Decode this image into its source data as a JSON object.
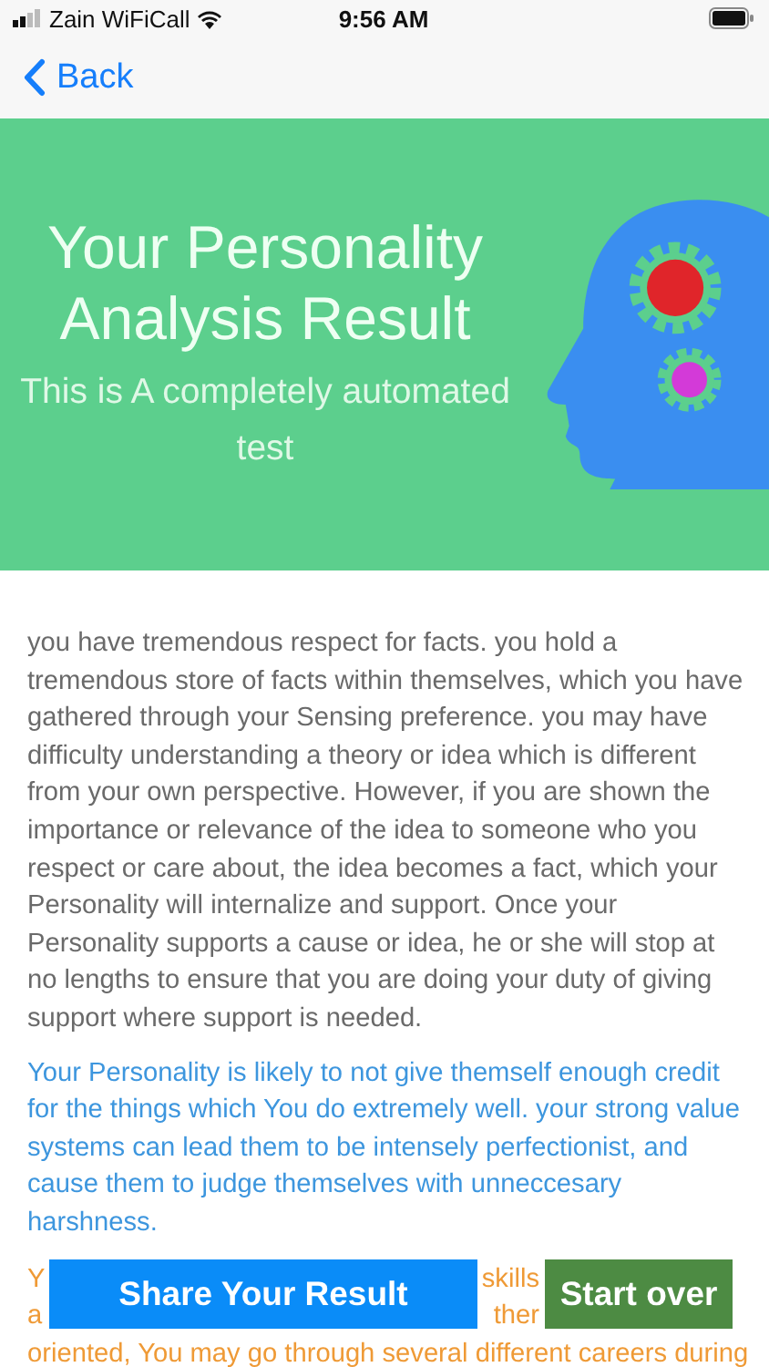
{
  "status_bar": {
    "carrier": "Zain WiFiCall",
    "time": "9:56 AM"
  },
  "nav": {
    "back": "Back"
  },
  "banner": {
    "title": "Your Personality Analysis Result",
    "subtitle": "This is A completely automated test"
  },
  "paragraphs": [
    {
      "kind": "gray",
      "text": "you have tremendous respect for facts. you hold a tremendous store of facts within themselves, which you have gathered through your Sensing preference. you may have difficulty understanding a theory or idea which is different from your own perspective. However, if you are shown the importance or relevance of the idea to someone who you respect or care about, the idea becomes a fact, which your Personality will internalize and support. Once your Personality supports a cause or idea, he or she will stop at no lengths to ensure that you are doing your duty of giving support where support is needed."
    },
    {
      "kind": "blue",
      "text": "Your Personality is likely to not give themself enough credit for the things which You do extremely well. your strong value systems can lead them to be intensely perfectionist, and cause them to judge themselves with unneccesary harshness."
    }
  ],
  "partial_paragraph": {
    "lines": [
      [
        "Y",
        "skills"
      ],
      [
        "a",
        "ther"
      ],
      [
        "oriented, You may go through several different careers during"
      ]
    ]
  },
  "buttons": [
    {
      "kind": "share",
      "label": "Share Your Result"
    },
    {
      "kind": "restart",
      "label": "Start over"
    }
  ]
}
